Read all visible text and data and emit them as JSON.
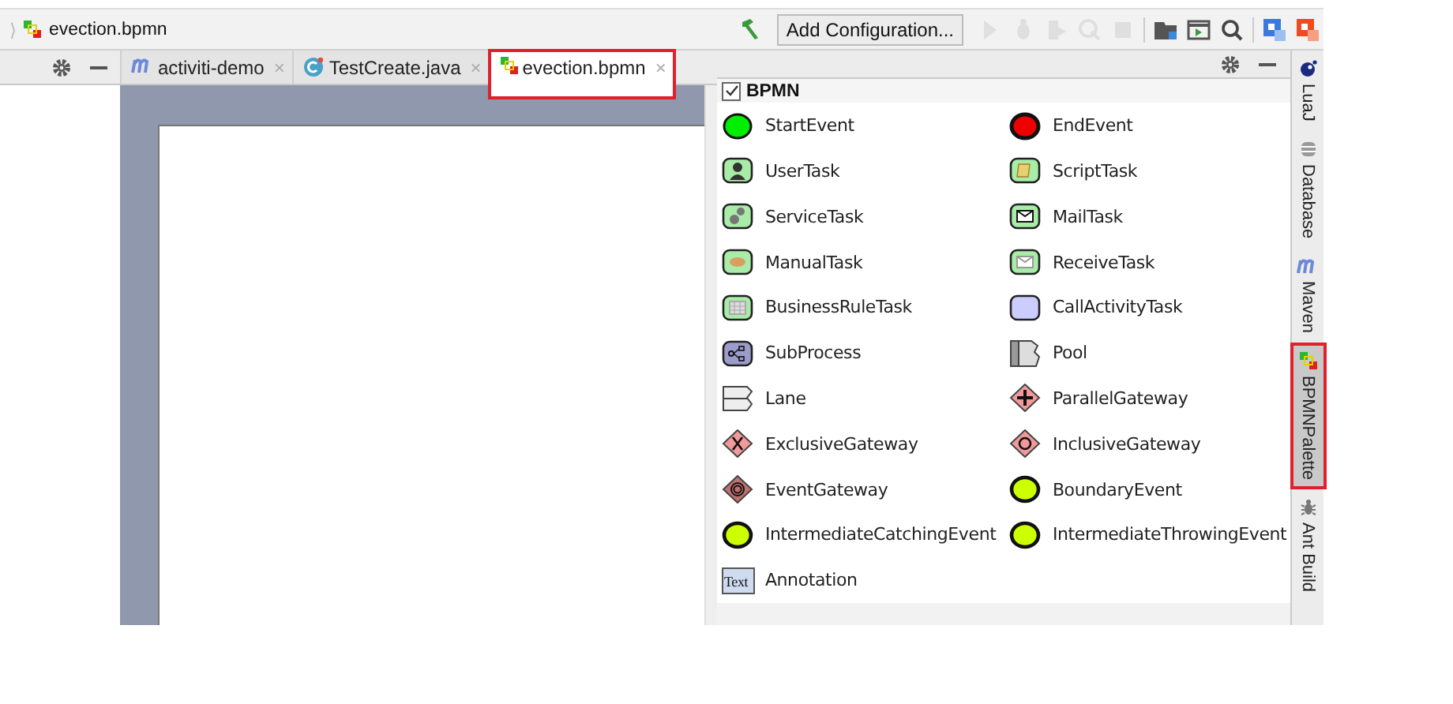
{
  "breadcrumb": {
    "file": "evection.bpmn",
    "separator": "⟩"
  },
  "toolbar": {
    "configuration": "Add Configuration...",
    "icons": [
      {
        "kind": "build",
        "disabled": false
      },
      {
        "kind": "run",
        "disabled": true
      },
      {
        "kind": "debug",
        "disabled": true
      },
      {
        "kind": "coverage",
        "disabled": true
      },
      {
        "kind": "profile",
        "disabled": true
      },
      {
        "kind": "stop",
        "disabled": true
      },
      {
        "kind": "structure",
        "disabled": false
      },
      {
        "kind": "terminal",
        "disabled": false
      },
      {
        "kind": "search",
        "disabled": false
      },
      {
        "kind": "translate",
        "disabled": false
      },
      {
        "kind": "translate2",
        "disabled": false
      }
    ]
  },
  "tabs": [
    {
      "label": "activiti-demo",
      "kind": "maven",
      "close": "×",
      "selected": false,
      "highlighted": false
    },
    {
      "label": "TestCreate.java",
      "kind": "class",
      "close": "×",
      "selected": false,
      "highlighted": false
    },
    {
      "label": "evection.bpmn",
      "kind": "bpmn",
      "close": "×",
      "selected": true,
      "highlighted": true
    }
  ],
  "palette": {
    "group": {
      "label": "BPMN",
      "checked": true
    },
    "items": [
      {
        "label": "StartEvent",
        "kind": "start"
      },
      {
        "label": "EndEvent",
        "kind": "end"
      },
      {
        "label": "UserTask",
        "kind": "user"
      },
      {
        "label": "ScriptTask",
        "kind": "script"
      },
      {
        "label": "ServiceTask",
        "kind": "service"
      },
      {
        "label": "MailTask",
        "kind": "mail"
      },
      {
        "label": "ManualTask",
        "kind": "manual"
      },
      {
        "label": "ReceiveTask",
        "kind": "receive"
      },
      {
        "label": "BusinessRuleTask",
        "kind": "rule"
      },
      {
        "label": "CallActivityTask",
        "kind": "call"
      },
      {
        "label": "SubProcess",
        "kind": "subprocess"
      },
      {
        "label": "Pool",
        "kind": "pool"
      },
      {
        "label": "Lane",
        "kind": "lane"
      },
      {
        "label": "ParallelGateway",
        "kind": "parallel"
      },
      {
        "label": "ExclusiveGateway",
        "kind": "exclusive"
      },
      {
        "label": "InclusiveGateway",
        "kind": "inclusive"
      },
      {
        "label": "EventGateway",
        "kind": "eventgateway"
      },
      {
        "label": "BoundaryEvent",
        "kind": "boundary"
      },
      {
        "label": "IntermediateCatchingEvent",
        "kind": "catching"
      },
      {
        "label": "IntermediateThrowingEvent",
        "kind": "throwing"
      },
      {
        "label": "Annotation",
        "kind": "annotation",
        "icon_text": "Text"
      }
    ]
  },
  "side_tabs": [
    {
      "label": "LuaJ",
      "kind": "lua",
      "selected": false,
      "highlighted": false
    },
    {
      "label": "Database",
      "kind": "database",
      "selected": false,
      "highlighted": false
    },
    {
      "label": "Maven",
      "kind": "maven",
      "selected": false,
      "highlighted": false
    },
    {
      "label": "BPMNPalette",
      "kind": "bpmn",
      "selected": true,
      "highlighted": true
    },
    {
      "label": "Ant Build",
      "kind": "ant",
      "selected": false,
      "highlighted": false
    }
  ]
}
